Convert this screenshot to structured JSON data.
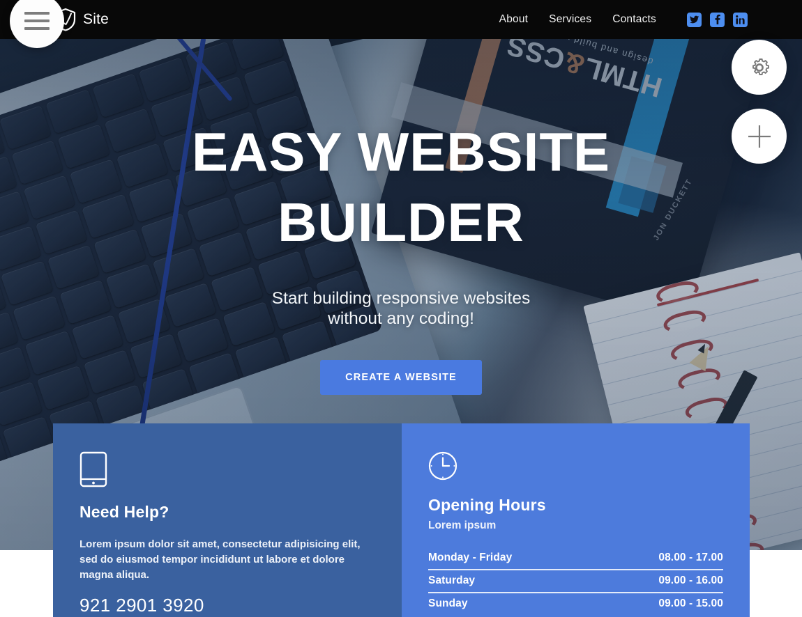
{
  "navbar": {
    "brand_name": "Site",
    "brand_icon": "shield-check-icon",
    "menu_icon": "hamburger-menu-icon",
    "links": [
      {
        "label": "About"
      },
      {
        "label": "Services"
      },
      {
        "label": "Contacts"
      }
    ],
    "social": [
      {
        "name": "twitter-icon",
        "color": "#4d8ef0"
      },
      {
        "name": "facebook-icon",
        "color": "#4d8ef0"
      },
      {
        "name": "linkedin-icon",
        "color": "#4d8ef0"
      }
    ]
  },
  "floating_buttons": [
    {
      "name": "settings-fab",
      "icon": "gear-icon"
    },
    {
      "name": "add-fab",
      "icon": "plus-icon"
    }
  ],
  "hero": {
    "title_line1": "EASY WEBSITE",
    "title_line2": "BUILDER",
    "subtitle_line1": "Start building responsive websites",
    "subtitle_line2": "without any coding!",
    "cta_label": "CREATE A WEBSITE",
    "cta_color": "#4a7ae0",
    "background_art": {
      "book_title_main": "HTML",
      "book_title_amp": "&",
      "book_title_second": "CSS",
      "book_subtitle": "design and build websites",
      "book_sidenote": "JON DUCKETT"
    }
  },
  "cards": {
    "help": {
      "icon": "mobile-phone-icon",
      "title": "Need Help?",
      "text": "Lorem ipsum dolor sit amet, consectetur adipisicing elit, sed do eiusmod tempor incididunt ut labore et dolore magna aliqua.",
      "phone": "921 2901 3920",
      "bg_color": "#3a619f"
    },
    "hours": {
      "icon": "clock-icon",
      "title": "Opening Hours",
      "subtitle": "Lorem ipsum",
      "bg_color": "#4d7bdc",
      "rows": [
        {
          "day": "Monday - Friday",
          "time": "08.00 - 17.00"
        },
        {
          "day": "Saturday",
          "time": "09.00 - 16.00"
        },
        {
          "day": "Sunday",
          "time": "09.00 - 15.00"
        }
      ]
    }
  }
}
